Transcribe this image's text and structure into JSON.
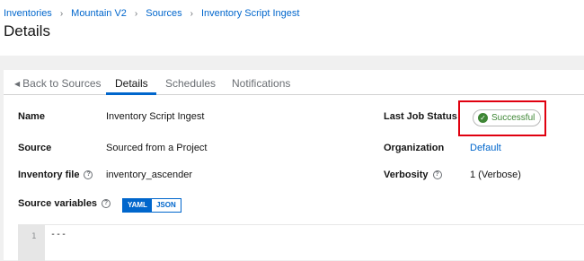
{
  "breadcrumb": [
    "Inventories",
    "Mountain V2",
    "Sources",
    "Inventory Script Ingest"
  ],
  "page_title": "Details",
  "tabs": {
    "back": "Back to Sources",
    "details": "Details",
    "schedules": "Schedules",
    "notifications": "Notifications"
  },
  "fields": {
    "name_label": "Name",
    "name_value": "Inventory Script Ingest",
    "source_label": "Source",
    "source_value": "Sourced from a Project",
    "inventory_file_label": "Inventory file",
    "inventory_file_value": "inventory_ascender",
    "source_variables_label": "Source variables",
    "last_job_status_label": "Last Job Status",
    "last_job_status_value": "Successful",
    "organization_label": "Organization",
    "organization_value": "Default",
    "verbosity_label": "Verbosity",
    "verbosity_value": "1 (Verbose)"
  },
  "toggle": {
    "yaml": "YAML",
    "json": "JSON",
    "selected": "YAML"
  },
  "editor": {
    "line_number": "1",
    "code": "---"
  },
  "icons": {
    "help": "help-circle-icon",
    "check": "check-circle-icon",
    "back": "caret-left-icon"
  },
  "colors": {
    "link": "#0066cc",
    "success": "#3e8635",
    "highlight": "#e0000f"
  }
}
